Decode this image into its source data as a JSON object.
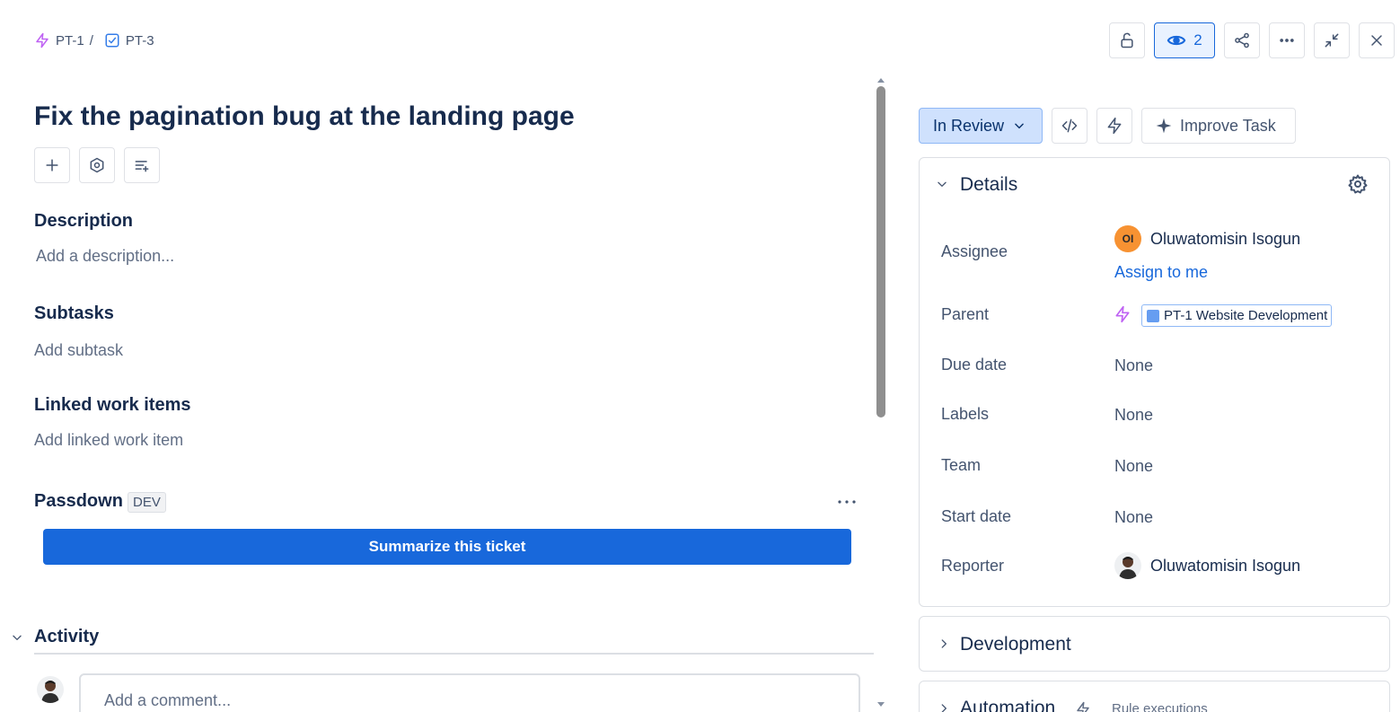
{
  "breadcrumb": {
    "parent_key": "PT-1",
    "separator": "/",
    "task_key": "PT-3"
  },
  "header_actions": {
    "watch_count": "2"
  },
  "task": {
    "title": "Fix the pagination bug at the landing page"
  },
  "sections": {
    "description": {
      "heading": "Description",
      "placeholder": "Add a description..."
    },
    "subtasks": {
      "heading": "Subtasks",
      "placeholder": "Add subtask"
    },
    "linked": {
      "heading": "Linked work items",
      "placeholder": "Add linked work item"
    },
    "passdown": {
      "heading": "Passdown",
      "badge": "DEV",
      "button_label": "Summarize this ticket"
    },
    "activity": {
      "heading": "Activity",
      "comment_placeholder": "Add a comment..."
    }
  },
  "status": {
    "label": "In Review"
  },
  "improve": {
    "label": "Improve Task"
  },
  "details": {
    "heading": "Details",
    "assignee": {
      "label": "Assignee",
      "initials": "OI",
      "name": "Oluwatomisin Isogun",
      "assign_link": "Assign to me"
    },
    "parent": {
      "label": "Parent",
      "value": "PT-1 Website Development"
    },
    "due_date": {
      "label": "Due date",
      "value": "None"
    },
    "labels": {
      "label": "Labels",
      "value": "None"
    },
    "team": {
      "label": "Team",
      "value": "None"
    },
    "start_date": {
      "label": "Start date",
      "value": "None"
    },
    "reporter": {
      "label": "Reporter",
      "name": "Oluwatomisin Isogun"
    }
  },
  "development": {
    "heading": "Development"
  },
  "automation": {
    "heading": "Automation",
    "sub": "Rule executions"
  },
  "colors": {
    "primary": "#1868db",
    "status_bg": "#cfe1fd",
    "avatar_orange": "#f79232",
    "epic_purple": "#bf63f3",
    "task_blue": "#357de8",
    "parent_square": "#669df1"
  }
}
